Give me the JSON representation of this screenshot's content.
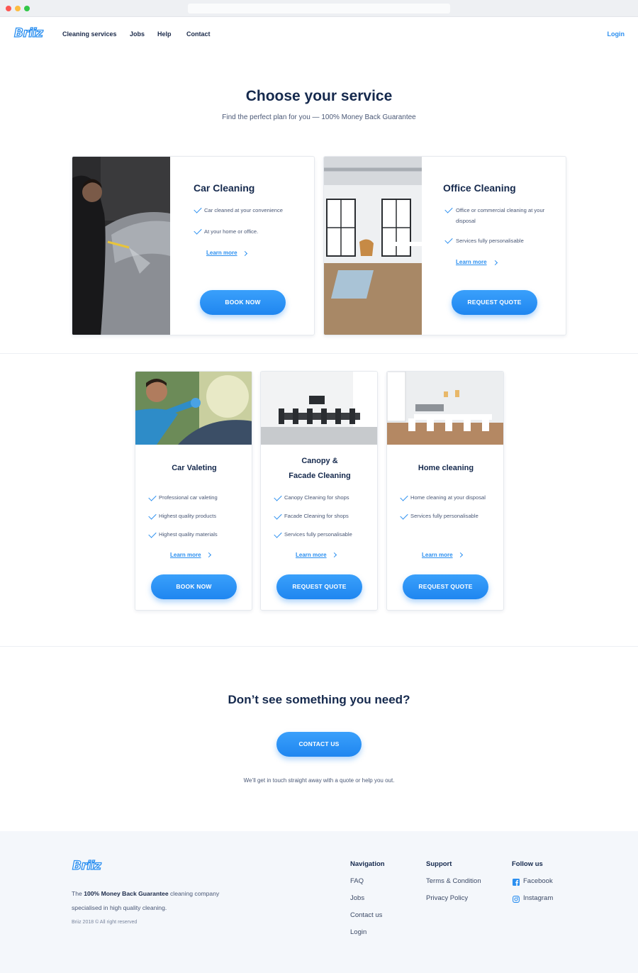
{
  "brand": {
    "logo_text": "Briiz",
    "accent_color": "#2b8ff0",
    "dark_color": "#15294d"
  },
  "nav": {
    "items": [
      "Cleaning services",
      "Jobs",
      "Help",
      "Contact"
    ],
    "login": "Login"
  },
  "hero": {
    "title": "Choose your service",
    "subtitle": "Find the perfect plan for you — 100% Money Back Guarantee"
  },
  "featured": [
    {
      "title": "Car Cleaning",
      "features": [
        "Car cleaned at your convenience",
        "At your home or office."
      ],
      "learn_more": "Learn more",
      "button": "BOOK NOW"
    },
    {
      "title": "Office Cleaning",
      "features": [
        "Office or commercial cleaning at your disposal",
        "Services fully personalisable"
      ],
      "learn_more": "Learn more",
      "button": "REQUEST QUOTE"
    }
  ],
  "services": [
    {
      "title_line1": "Car Valeting",
      "title_line2": "",
      "features": [
        "Professional car valeting",
        "Highest quality products",
        "Highest quality materials"
      ],
      "learn_more": "Learn more",
      "button": "BOOK NOW"
    },
    {
      "title_line1": "Canopy &",
      "title_line2": "Facade Cleaning",
      "features": [
        "Canopy Cleaning for shops",
        "Facade Cleaning for shops",
        "Services fully personalisable"
      ],
      "learn_more": "Learn more",
      "button": "REQUEST QUOTE"
    },
    {
      "title_line1": "Home cleaning",
      "title_line2": "",
      "features": [
        "Home cleaning at your disposal",
        "Services fully personalisable"
      ],
      "learn_more": "Learn more",
      "button": "REQUEST QUOTE"
    }
  ],
  "cta": {
    "title": "Don’t see something you need?",
    "button": "CONTACT US",
    "text": "We’ll get in touch straight away with a quote or help you out."
  },
  "footer": {
    "tagline_pre": "The ",
    "tagline_bold": "100% Money Back Guarantee",
    "tagline_post": " cleaning company specialised in high quality cleaning.",
    "copyright": "Briiz 2018 © All right reserved",
    "navigation": {
      "title": "Navigation",
      "links": [
        "FAQ",
        "Jobs",
        "Contact us",
        "Login"
      ]
    },
    "support": {
      "title": "Support",
      "links": [
        "Terms & Condition",
        "Privacy Policy"
      ]
    },
    "follow": {
      "title": "Follow us",
      "links": [
        {
          "label": "Facebook",
          "icon": "facebook-icon"
        },
        {
          "label": "Instagram",
          "icon": "instagram-icon"
        }
      ]
    }
  }
}
